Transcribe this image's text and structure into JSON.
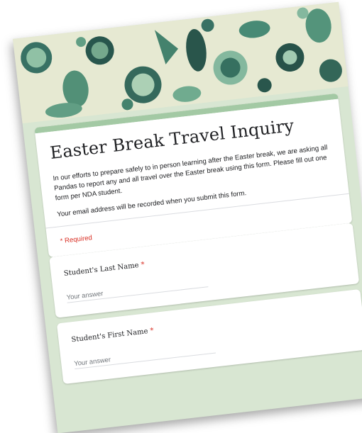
{
  "form": {
    "title": "Easter Break Travel Inquiry",
    "description": "In our efforts to prepare safely to in person learning after the Easter break, we are asking all Pandas to report any and all travel over the Easter break using this form. Please fill out one form per NDA student.",
    "email_notice": "Your email address will be recorded when you submit this form.",
    "required_note": "* Required",
    "accent_color": "#a3c9a4"
  },
  "questions": [
    {
      "label": "Student's Last Name",
      "required_marker": "*",
      "placeholder": "Your answer"
    },
    {
      "label": "Student's First Name",
      "required_marker": "*",
      "placeholder": "Your answer"
    }
  ]
}
